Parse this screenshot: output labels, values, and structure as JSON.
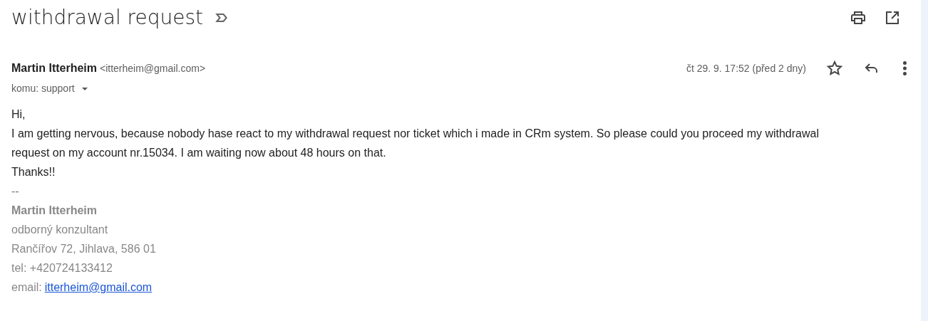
{
  "subject": "withdrawal request",
  "sender": {
    "name": "Martin Itterheim",
    "email": "<itterheim@gmail.com>"
  },
  "recipient": "komu: support",
  "date": "čt 29. 9. 17:52 (před 2 dny)",
  "starred": false,
  "body": [
    "Hi,",
    "I am getting nervous, because nobody hase react to my withdrawal request nor ticket which i made in CRm system. So please could you proceed my withdrawal request on my account nr.15034. I am waiting now about 48 hours on that.",
    "Thanks!!"
  ],
  "signature": {
    "separator": "--",
    "name": "Martin Itterheim",
    "lines": [
      "odborný konzultant",
      "Rančířov 72, Jihlava, 586 01",
      "tel: +420724133412"
    ],
    "email_label": "email:",
    "email_link": "itterheim@gmail.com"
  }
}
